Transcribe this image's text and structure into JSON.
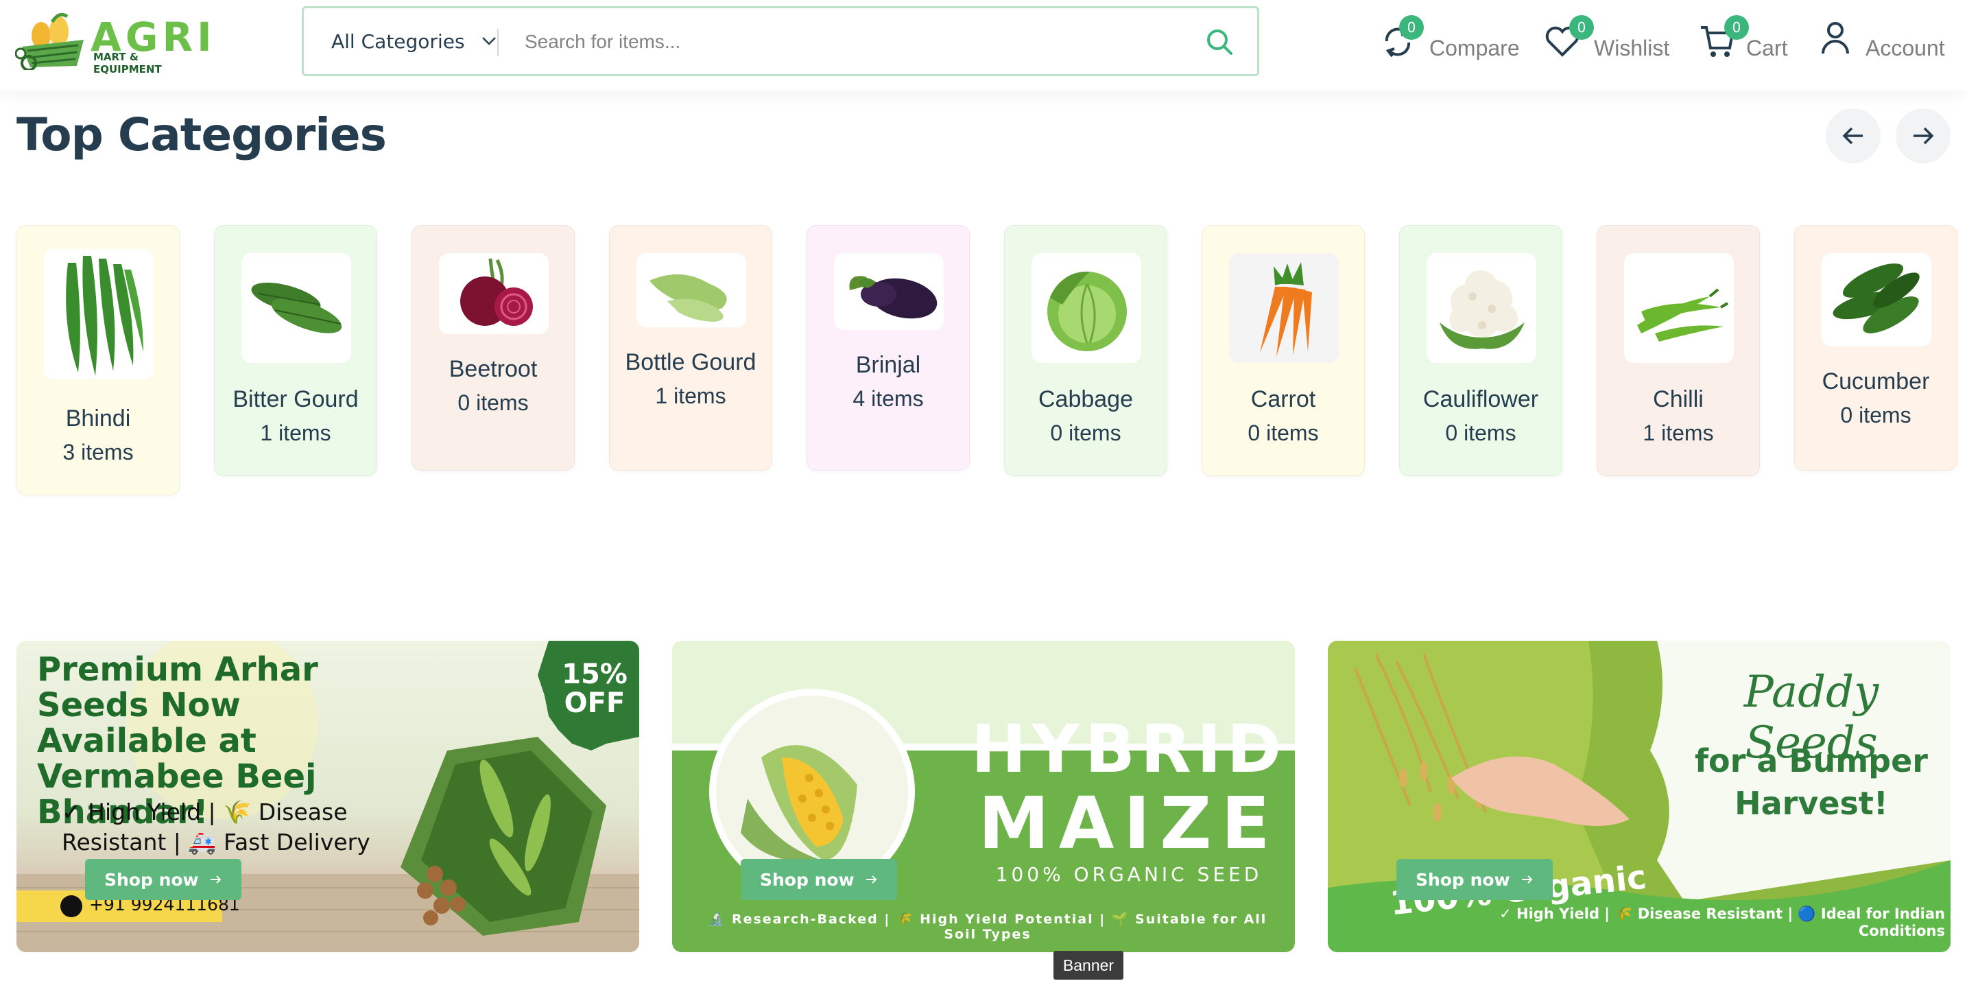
{
  "header": {
    "logo_main": "AGRI",
    "logo_sub": "MART & EQUIPMENT",
    "category_select": "All Categories",
    "search_placeholder": "Search for items...",
    "actions": [
      {
        "label": "Compare",
        "count": "0"
      },
      {
        "label": "Wishlist",
        "count": "0"
      },
      {
        "label": "Cart",
        "count": "0"
      },
      {
        "label": "Account"
      }
    ]
  },
  "categories": {
    "title": "Top Categories",
    "items": [
      {
        "name": "Bhindi",
        "count": "3 items",
        "bg": "#fefbe7"
      },
      {
        "name": "Bitter Gourd",
        "count": "1 items",
        "bg": "#ecfbe9"
      },
      {
        "name": "Beetroot",
        "count": "0 items",
        "bg": "#fbf0e9"
      },
      {
        "name": "Bottle Gourd",
        "count": "1 items",
        "bg": "#fff2e9"
      },
      {
        "name": "Brinjal",
        "count": "4 items",
        "bg": "#fdf0fb"
      },
      {
        "name": "Cabbage",
        "count": "0 items",
        "bg": "#eefae9"
      },
      {
        "name": "Carrot",
        "count": "0 items",
        "bg": "#fefbe7"
      },
      {
        "name": "Cauliflower",
        "count": "0 items",
        "bg": "#ecfbe9"
      },
      {
        "name": "Chilli",
        "count": "1 items",
        "bg": "#fbf0e9"
      },
      {
        "name": "Cucumber",
        "count": "0 items",
        "bg": "#fff2e9"
      }
    ]
  },
  "banners": [
    {
      "headline": "Premium Arhar Seeds Now Available at Vermabee Beej Bhandar!",
      "features": "✓ High Yield | 🌾 Disease Resistant | 🚑 Fast Delivery",
      "discount": "15% OFF",
      "phone": "+91 9924111681",
      "button": "Shop now"
    },
    {
      "title_line1": "HYBRID",
      "title_line2": "MAIZE",
      "subtitle": "100% ORGANIC SEED",
      "features": "🔬 Research-Backed | 🌾 High Yield Potential | 🌱 Suitable for All Soil Types",
      "button": "Shop now"
    },
    {
      "title_script": "Paddy Seeds",
      "title_line2": "for a Bumper",
      "title_line3": "Harvest!",
      "overlay_text": "100% Organic",
      "features": "✓ High Yield | 🌾 Disease Resistant | 🔵 Ideal for Indian Conditions",
      "button": "Shop now"
    }
  ],
  "tooltip": "Banner",
  "colors": {
    "accent": "#3bb77e",
    "heading": "#253d4e"
  }
}
